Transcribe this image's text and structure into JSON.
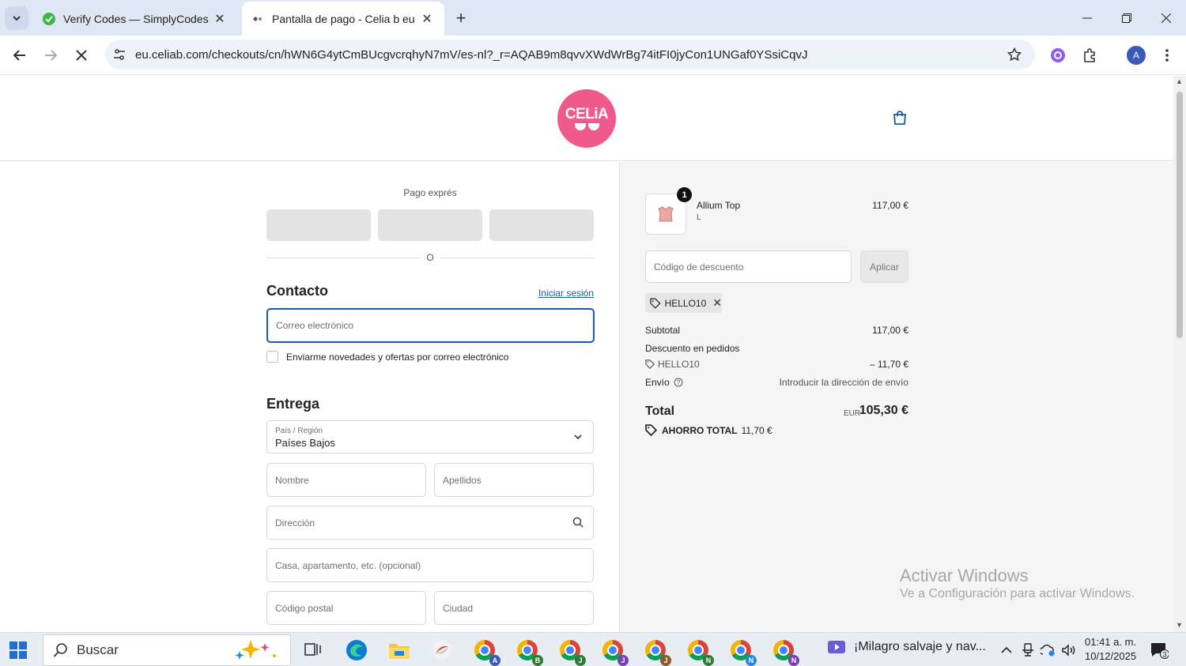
{
  "browser": {
    "tabs": [
      {
        "title": "Verify Codes — SimplyCodes",
        "active": false
      },
      {
        "title": "Pantalla de pago - Celia b eu",
        "active": true
      }
    ],
    "url": "eu.celiab.com/checkouts/cn/hWN6G4ytCmBUcgvcrqhyN7mV/es-nl?_r=AQAB9m8qvvXWdWrBg74itFI0jyCon1UNGaf0YSsiCqvJ",
    "profile_initial": "A"
  },
  "header": {
    "logo_text": "CELiA"
  },
  "checkout": {
    "express_label": "Pago exprés",
    "or_label": "O",
    "contact_title": "Contacto",
    "login_link": "Iniciar sesión",
    "email_placeholder": "Correo electrónico",
    "newsletter_label": "Enviarme novedades y ofertas por correo electrónico",
    "delivery_title": "Entrega",
    "country_label": "País / Región",
    "country_value": "Países Bajos",
    "first_name_placeholder": "Nombre",
    "last_name_placeholder": "Apellidos",
    "address_placeholder": "Dirección",
    "apartment_placeholder": "Casa, apartamento, etc. (opcional)",
    "postal_placeholder": "Código postal",
    "city_placeholder": "Ciudad"
  },
  "summary": {
    "item": {
      "name": "Allium Top",
      "variant": "L",
      "price": "117,00 €",
      "quantity": "1"
    },
    "discount_placeholder": "Código de descuento",
    "apply_label": "Aplicar",
    "applied_code": "HELLO10",
    "subtotal_label": "Subtotal",
    "subtotal_value": "117,00 €",
    "order_discount_label": "Descuento en pedidos",
    "order_discount_code": "HELLO10",
    "order_discount_value": "– 11,70 €",
    "shipping_label": "Envío",
    "shipping_value": "Introducir la dirección de envío",
    "total_label": "Total",
    "total_currency": "EUR",
    "total_value": "105,30 €",
    "savings_label": "AHORRO TOTAL",
    "savings_value": "11,70 €"
  },
  "watermark": {
    "line1": "Activar Windows",
    "line2": "Ve a Configuración para activar Windows."
  },
  "taskbar": {
    "search_label": "Buscar",
    "chrome_profiles": [
      "A",
      "B",
      "J",
      "J",
      "J",
      "N",
      "N",
      "N"
    ],
    "profile_colors": [
      "#3c58b8",
      "#2e7d32",
      "#2e7d32",
      "#7b3fb5",
      "#8d5a2b",
      "#2e7d32",
      "#1e88e5",
      "#7b3fb5"
    ],
    "media_title": "¡Milagro salvaje y nav...",
    "time": "01:41 a. m.",
    "date": "10/12/2025",
    "notification_count": "3"
  }
}
